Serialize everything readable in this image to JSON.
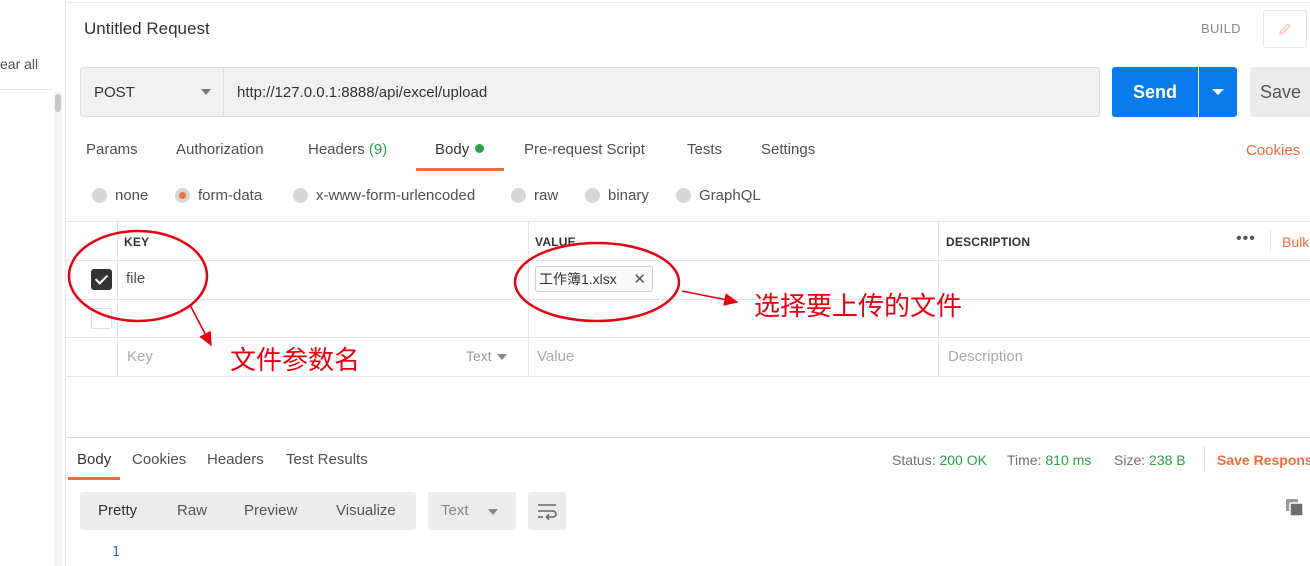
{
  "sidebar": {
    "clear_all": "ear all"
  },
  "request": {
    "title": "Untitled Request",
    "build_label": "BUILD",
    "method": "POST",
    "url": "http://127.0.0.1:8888/api/excel/upload",
    "send_label": "Send",
    "save_label": "Save"
  },
  "tabs": [
    {
      "label": "Params"
    },
    {
      "label": "Authorization"
    },
    {
      "label": "Headers",
      "count": "(9)"
    },
    {
      "label": "Body",
      "active": true
    },
    {
      "label": "Pre-request Script"
    },
    {
      "label": "Tests"
    },
    {
      "label": "Settings"
    }
  ],
  "cookies_label": "Cookies",
  "body_types": [
    {
      "label": "none"
    },
    {
      "label": "form-data",
      "selected": true
    },
    {
      "label": "x-www-form-urlencoded"
    },
    {
      "label": "raw"
    },
    {
      "label": "binary"
    },
    {
      "label": "GraphQL"
    }
  ],
  "params_table": {
    "columns": [
      "KEY",
      "VALUE",
      "DESCRIPTION"
    ],
    "more_label": "•••",
    "bulk_label": "Bulk",
    "rows": [
      {
        "checked": true,
        "key": "file",
        "value_file": "工作簿1.xlsx"
      }
    ],
    "new_row": {
      "key_placeholder": "Key",
      "key_type": "Text",
      "value_placeholder": "Value",
      "description_placeholder": "Description"
    }
  },
  "response": {
    "tabs": [
      "Body",
      "Cookies",
      "Headers",
      "Test Results"
    ],
    "status_label": "Status:",
    "status_value": "200 OK",
    "time_label": "Time:",
    "time_value": "810 ms",
    "size_label": "Size:",
    "size_value": "238 B",
    "save_response_label": "Save Respons",
    "view_modes": [
      "Pretty",
      "Raw",
      "Preview",
      "Visualize"
    ],
    "format": "Text",
    "line_number": "1"
  },
  "annotations": {
    "param_name_note": "文件参数名",
    "file_select_note": "选择要上传的文件"
  },
  "colors": {
    "accent": "#f26b3a",
    "send": "#097bed",
    "success": "#26a34b",
    "annotation": "#e60012"
  }
}
